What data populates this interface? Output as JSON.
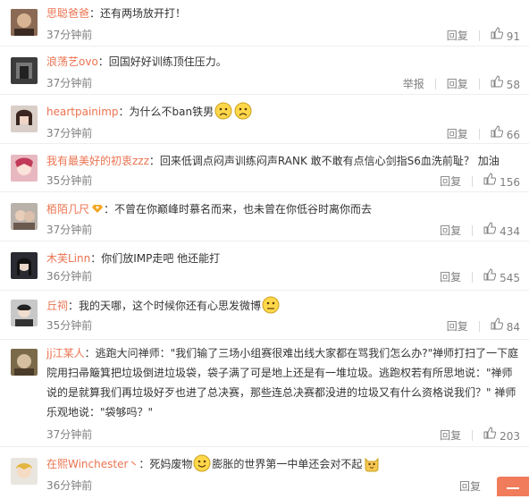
{
  "comments": [
    {
      "user": "思聪爸爸",
      "text": "：还有两场放开打！",
      "time": "37分钟前",
      "reply": "回复",
      "likes": "91",
      "report": ""
    },
    {
      "user": "浪荡艺ovo",
      "text": "：回国好好训练顶住压力。",
      "time": "37分钟前",
      "reply": "回复",
      "likes": "58",
      "report": "举报"
    },
    {
      "user": "heartpainimp",
      "text": "：为什么不ban铁男",
      "time": "37分钟前",
      "reply": "回复",
      "likes": "66",
      "report": ""
    },
    {
      "user": "我有最美好的初衷zzz",
      "text": "：回来低调点闷声训练闷声RANK 敢不敢有点信心剑指S6血洗前耻？ 加油",
      "time": "35分钟前",
      "reply": "回复",
      "likes": "156",
      "report": ""
    },
    {
      "user": "栢陌几尺",
      "text": "：不曾在你巅峰时慕名而来，也未曾在你低谷时离你而去",
      "time": "37分钟前",
      "reply": "回复",
      "likes": "434",
      "report": ""
    },
    {
      "user": "木芙Linn",
      "text": "：你们放IMP走吧 他还能打",
      "time": "36分钟前",
      "reply": "回复",
      "likes": "545",
      "report": ""
    },
    {
      "user": "丘祠",
      "text": "：我的天哪，这个时候你还有心思发微博",
      "time": "35分钟前",
      "reply": "回复",
      "likes": "84",
      "report": ""
    },
    {
      "user": "jj江某人",
      "text": "：逃跑大问禅师：\"我们输了三场小组赛很难出线大家都在骂我们怎么办?\"禅师打扫了一下庭院用扫帚簸箕把垃圾倒进垃圾袋，袋子满了可是地上还是有一堆垃圾。逃跑权若有所思地说：\"禅师说的是就算我们再垃圾好歹也进了总决赛，那些连总决赛都没进的垃圾又有什么资格说我们？\" 禅师乐观地说：\"袋够吗？\"",
      "time": "37分钟前",
      "reply": "回复",
      "likes": "203",
      "report": ""
    },
    {
      "user": "在熙Winchester丶",
      "text": "：死妈废物",
      "text2": "膨胀的世界第一中单还会对不起",
      "time": "36分钟前",
      "reply": "回复",
      "likes": "",
      "report": ""
    }
  ],
  "colors": {
    "accent": "#eb7350",
    "meta": "#808080",
    "corner": "#f07c5b"
  }
}
